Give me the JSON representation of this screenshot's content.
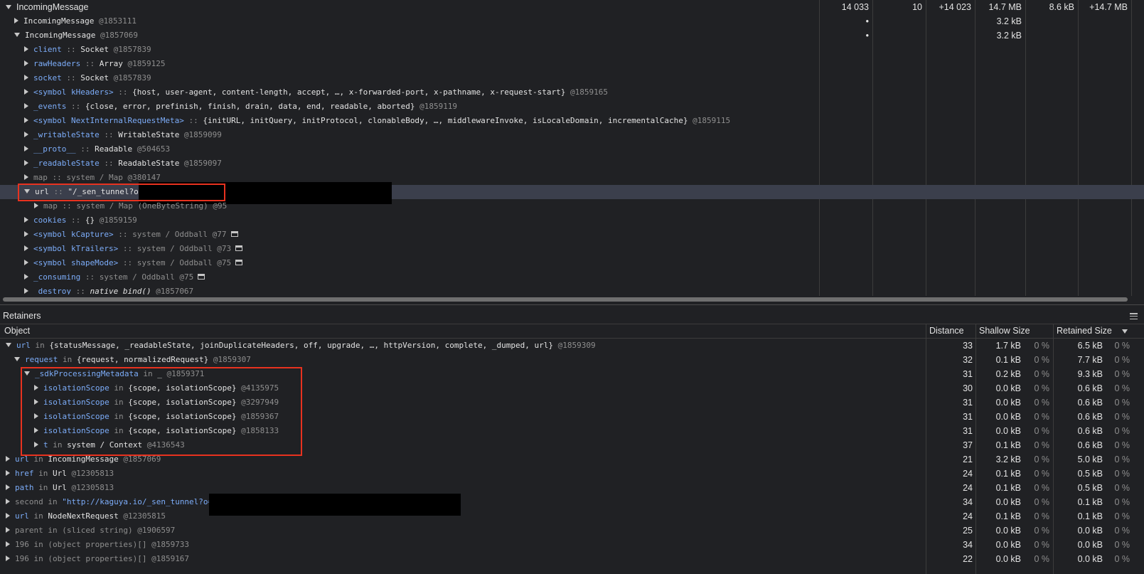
{
  "top": {
    "root": {
      "name": "IncomingMessage",
      "c1": "14 033",
      "c2": "10",
      "c3": "+14 023",
      "c4": "14.7 MB",
      "c5": "8.6 kB",
      "c6": "+14.7 MB"
    },
    "rows": [
      {
        "name": "IncomingMessage",
        "rest": " @1853111",
        "c1": "•",
        "c4": "3.2 kB"
      },
      {
        "name": "IncomingMessage",
        "rest": " @1857069",
        "c1": "•",
        "c4": "3.2 kB"
      },
      {
        "name": "client",
        "sep": " :: ",
        "val": "Socket",
        "id": " @1857839"
      },
      {
        "name": "rawHeaders",
        "sep": " :: ",
        "val": "Array",
        "id": " @1859125"
      },
      {
        "name": "socket",
        "sep": " :: ",
        "val": "Socket",
        "id": " @1857839"
      },
      {
        "name": "<symbol kHeaders>",
        "sep": " :: ",
        "val": "{host, user-agent, content-length, accept, …, x-forwarded-port, x-pathname, x-request-start}",
        "id": " @1859165"
      },
      {
        "name": "_events",
        "sep": " :: ",
        "val": "{close, error, prefinish, finish, drain, data, end, readable, aborted}",
        "id": " @1859119"
      },
      {
        "name": "<symbol NextInternalRequestMeta>",
        "sep": " :: ",
        "val": "{initURL, initQuery, initProtocol, clonableBody, …, middlewareInvoke, isLocaleDomain, incrementalCache}",
        "id": " @1859115"
      },
      {
        "name": "_writableState",
        "sep": " :: ",
        "val": "WritableState",
        "id": " @1859099"
      },
      {
        "name": "__proto__",
        "sep": " :: ",
        "val": "Readable",
        "id": " @504653"
      },
      {
        "name": "_readableState",
        "sep": " :: ",
        "val": "ReadableState",
        "id": " @1859097"
      },
      {
        "name": "map",
        "sep": " :: ",
        "val": "system / Map",
        "id": " @380147"
      },
      {
        "name": "url",
        "sep": " :: ",
        "val": "\"/_sen_tunnel?o=",
        "id": ""
      },
      {
        "name": "map",
        "sep": " :: ",
        "val": "system / Map (OneByteString)",
        "id": " @95"
      },
      {
        "name": "cookies",
        "sep": " :: ",
        "val": "{}",
        "id": " @1859159"
      },
      {
        "name": "<symbol kCapture>",
        "sep": " :: ",
        "val": "system / Oddball",
        "id": " @77"
      },
      {
        "name": "<symbol kTrailers>",
        "sep": " :: ",
        "val": "system / Oddball",
        "id": " @73"
      },
      {
        "name": "<symbol shapeMode>",
        "sep": " :: ",
        "val": "system / Oddball",
        "id": " @75"
      },
      {
        "name": "_consuming",
        "sep": " :: ",
        "val": "system / Oddball",
        "id": " @75"
      },
      {
        "name": "_destroy",
        "sep": " :: ",
        "val": "native_bind()",
        "id": " @1857067"
      }
    ]
  },
  "retainers": {
    "title": "Retainers",
    "menu_icon": "hamburger-icon",
    "columns": {
      "object": "Object",
      "distance": "Distance",
      "shallow": "Shallow Size",
      "retained": "Retained Size"
    },
    "rows": [
      {
        "name": "url",
        "mid": " in ",
        "val": "{statusMessage, _readableState, joinDuplicateHeaders, off, upgrade, …, httpVersion, complete, _dumped, url}",
        "id": " @1859309",
        "dist": "33",
        "sh": "1.7 kB",
        "shp": "0 %",
        "ret": "6.5 kB",
        "retp": "0 %"
      },
      {
        "name": "request",
        "mid": " in ",
        "val": "{request, normalizedRequest}",
        "id": " @1859307",
        "dist": "32",
        "sh": "0.1 kB",
        "shp": "0 %",
        "ret": "7.7 kB",
        "retp": "0 %"
      },
      {
        "name": "_sdkProcessingMetadata",
        "mid": " in ",
        "val": "_",
        "id": " @1859371",
        "dist": "31",
        "sh": "0.2 kB",
        "shp": "0 %",
        "ret": "9.3 kB",
        "retp": "0 %"
      },
      {
        "name": "isolationScope",
        "mid": " in ",
        "val": "{scope, isolationScope}",
        "id": " @4135975",
        "dist": "30",
        "sh": "0.0 kB",
        "shp": "0 %",
        "ret": "0.6 kB",
        "retp": "0 %"
      },
      {
        "name": "isolationScope",
        "mid": " in ",
        "val": "{scope, isolationScope}",
        "id": " @3297949",
        "dist": "31",
        "sh": "0.0 kB",
        "shp": "0 %",
        "ret": "0.6 kB",
        "retp": "0 %"
      },
      {
        "name": "isolationScope",
        "mid": " in ",
        "val": "{scope, isolationScope}",
        "id": " @1859367",
        "dist": "31",
        "sh": "0.0 kB",
        "shp": "0 %",
        "ret": "0.6 kB",
        "retp": "0 %"
      },
      {
        "name": "isolationScope",
        "mid": " in ",
        "val": "{scope, isolationScope}",
        "id": " @1858133",
        "dist": "31",
        "sh": "0.0 kB",
        "shp": "0 %",
        "ret": "0.6 kB",
        "retp": "0 %"
      },
      {
        "name": "t",
        "mid": " in ",
        "val": "system / Context",
        "id": " @4136543",
        "dist": "37",
        "sh": "0.1 kB",
        "shp": "0 %",
        "ret": "0.6 kB",
        "retp": "0 %"
      },
      {
        "name": "url",
        "mid": " in ",
        "val": "IncomingMessage",
        "id": " @1857069",
        "dist": "21",
        "sh": "3.2 kB",
        "shp": "0 %",
        "ret": "5.0 kB",
        "retp": "0 %"
      },
      {
        "name": "href",
        "mid": " in ",
        "val": "Url",
        "id": " @12305813",
        "dist": "24",
        "sh": "0.1 kB",
        "shp": "0 %",
        "ret": "0.5 kB",
        "retp": "0 %"
      },
      {
        "name": "path",
        "mid": " in ",
        "val": "Url",
        "id": " @12305813",
        "dist": "24",
        "sh": "0.1 kB",
        "shp": "0 %",
        "ret": "0.5 kB",
        "retp": "0 %"
      },
      {
        "name": "second",
        "mid": " in ",
        "val": "\"http://kaguya.io/_sen_tunnel?o=",
        "id": "",
        "dist": "34",
        "sh": "0.0 kB",
        "shp": "0 %",
        "ret": "0.1 kB",
        "retp": "0 %"
      },
      {
        "name": "url",
        "mid": " in ",
        "val": "NodeNextRequest",
        "id": " @12305815",
        "dist": "24",
        "sh": "0.1 kB",
        "shp": "0 %",
        "ret": "0.1 kB",
        "retp": "0 %"
      },
      {
        "name": "parent",
        "mid": " in ",
        "val": "(sliced string)",
        "id": " @1906597",
        "dist": "25",
        "sh": "0.0 kB",
        "shp": "0 %",
        "ret": "0.0 kB",
        "retp": "0 %"
      },
      {
        "name": "196",
        "mid": " in ",
        "val": "(object properties)[]",
        "id": " @1859733",
        "dist": "34",
        "sh": "0.0 kB",
        "shp": "0 %",
        "ret": "0.0 kB",
        "retp": "0 %"
      },
      {
        "name": "196",
        "mid": " in ",
        "val": "(object properties)[]",
        "id": " @1859167",
        "dist": "22",
        "sh": "0.0 kB",
        "shp": "0 %",
        "ret": "0.0 kB",
        "retp": "0 %"
      }
    ]
  }
}
